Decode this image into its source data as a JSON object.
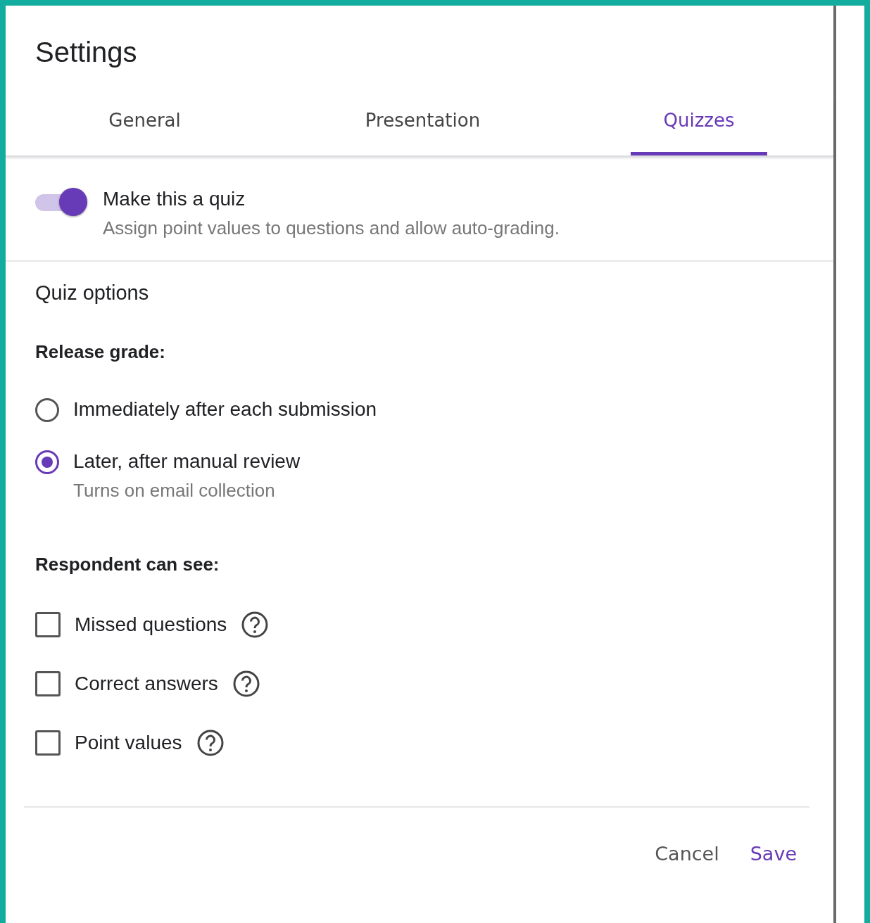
{
  "dialog": {
    "title": "Settings"
  },
  "tabs": [
    {
      "label": "General",
      "selected": false
    },
    {
      "label": "Presentation",
      "selected": false
    },
    {
      "label": "Quizzes",
      "selected": true
    }
  ],
  "quiz_toggle": {
    "label": "Make this a quiz",
    "description": "Assign point values to questions and allow auto-grading.",
    "on": true
  },
  "section_title": "Quiz options",
  "release_grade": {
    "heading": "Release grade:",
    "options": [
      {
        "label": "Immediately after each submission",
        "selected": false
      },
      {
        "label": "Later, after manual review",
        "hint": "Turns on email collection",
        "selected": true
      }
    ]
  },
  "respondent_can_see": {
    "heading": "Respondent can see:",
    "options": [
      {
        "label": "Missed questions",
        "checked": false
      },
      {
        "label": "Correct answers",
        "checked": false
      },
      {
        "label": "Point values",
        "checked": false
      }
    ]
  },
  "buttons": [
    {
      "label": "Cancel",
      "kind": "secondary"
    },
    {
      "label": "Save",
      "kind": "primary"
    }
  ]
}
